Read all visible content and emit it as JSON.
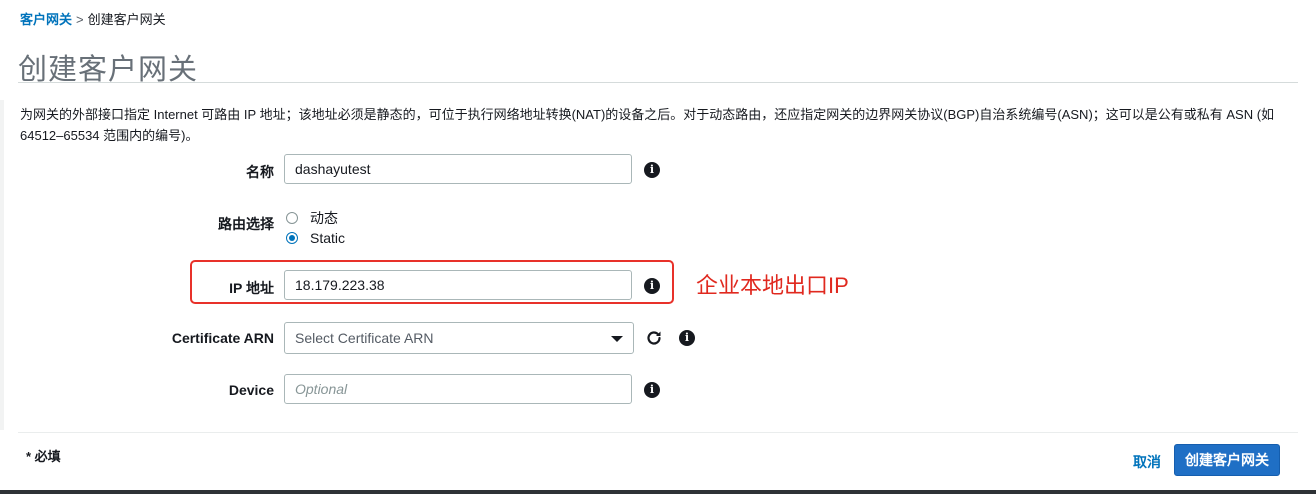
{
  "breadcrumb": {
    "parent": "客户网关",
    "separator": ">",
    "current": "创建客户网关"
  },
  "page_title": "创建客户网关",
  "description": "为网关的外部接口指定 Internet 可路由 IP 地址；该地址必须是静态的，可位于执行网络地址转换(NAT)的设备之后。对于动态路由，还应指定网关的边界网关协议(BGP)自治系统编号(ASN)；这可以是公有或私有 ASN (如 64512–65534 范围内的编号)。",
  "form": {
    "name": {
      "label": "名称",
      "value": "dashayutest"
    },
    "routing": {
      "label": "路由选择",
      "options": [
        "动态",
        "Static"
      ],
      "selected": "Static"
    },
    "ip": {
      "label": "IP 地址",
      "value": "18.179.223.38"
    },
    "certificate": {
      "label": "Certificate ARN",
      "placeholder": "Select Certificate ARN"
    },
    "device": {
      "label": "Device",
      "placeholder": "Optional"
    }
  },
  "annotation": "企业本地出口IP",
  "footer": {
    "required_note": "* 必填",
    "cancel_label": "取消",
    "create_label": "创建客户网关"
  },
  "colors": {
    "link": "#0073bb",
    "primary": "#1f6fc5",
    "annotation": "#e0291f"
  },
  "icons": [
    "info-icon",
    "refresh-icon",
    "dropdown-caret-icon"
  ]
}
